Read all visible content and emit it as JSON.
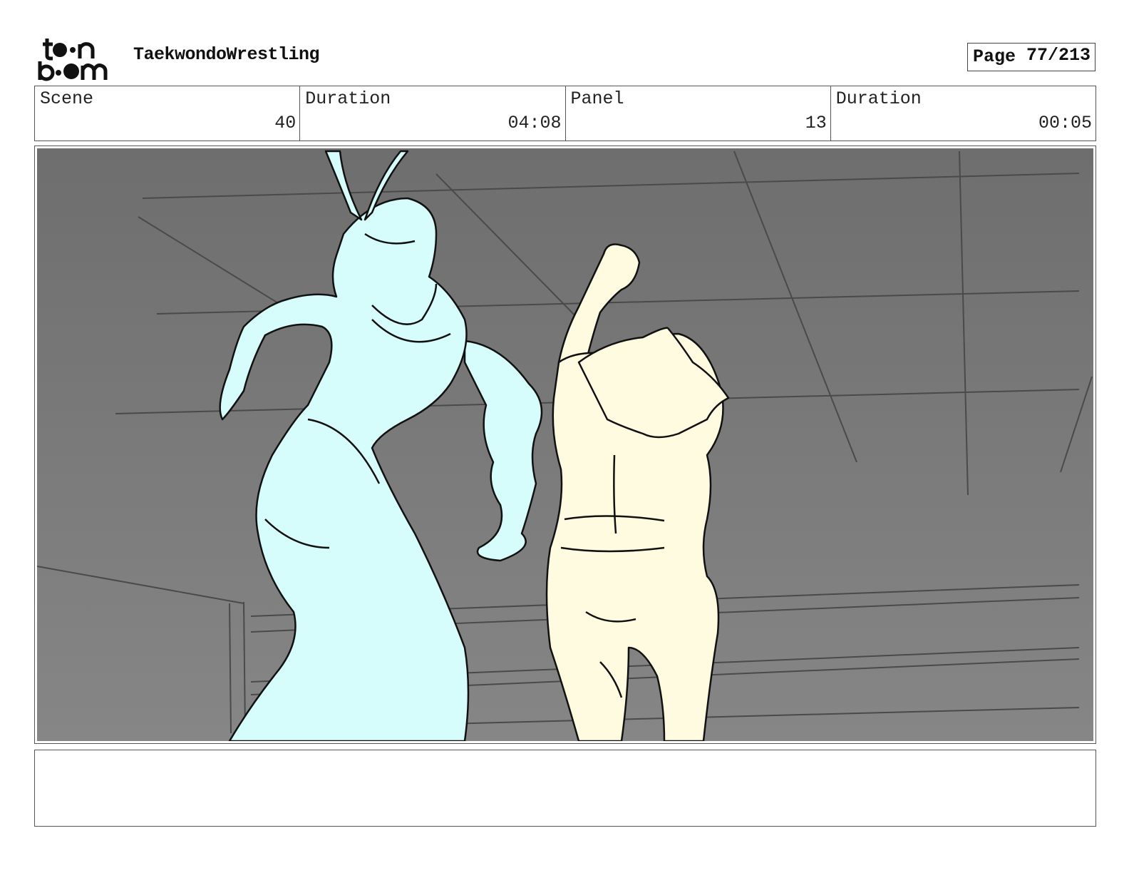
{
  "header": {
    "logo_text": "toon boom",
    "project_title": "TaekwondoWrestling",
    "page_label": "Page",
    "page_value": "77/213"
  },
  "info": {
    "scene_label": "Scene",
    "scene_value": "40",
    "scene_duration_label": "Duration",
    "scene_duration_value": "04:08",
    "panel_label": "Panel",
    "panel_value": "13",
    "panel_duration_label": "Duration",
    "panel_duration_value": "00:05"
  },
  "colors": {
    "background_gray": "#7a7a7a",
    "figure_left_fill": "#d6fdfb",
    "figure_right_fill": "#fffbe0",
    "line_color": "#111111"
  },
  "notes": {
    "text": ""
  }
}
